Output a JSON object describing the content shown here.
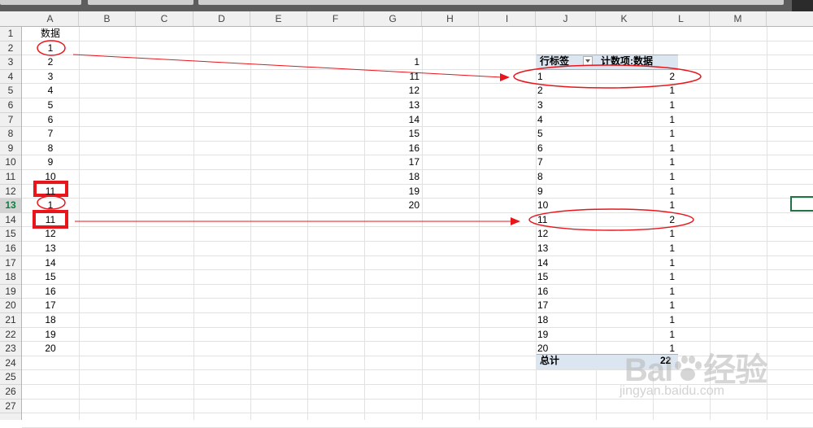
{
  "columns": [
    "A",
    "B",
    "C",
    "D",
    "E",
    "F",
    "G",
    "H",
    "I",
    "J",
    "K",
    "L",
    "M"
  ],
  "rows": [
    "1",
    "2",
    "3",
    "4",
    "5",
    "6",
    "7",
    "8",
    "9",
    "10",
    "11",
    "12",
    "13",
    "14",
    "15",
    "16",
    "17",
    "18",
    "19",
    "20",
    "21",
    "22",
    "23",
    "24",
    "25",
    "26",
    "27"
  ],
  "active_row": "13",
  "colA": {
    "header": "数据",
    "values": [
      "1",
      "2",
      "3",
      "4",
      "5",
      "6",
      "7",
      "8",
      "9",
      "10",
      "11",
      "1",
      "11",
      "12",
      "13",
      "14",
      "15",
      "16",
      "17",
      "18",
      "19",
      "20"
    ]
  },
  "colG": {
    "values": [
      "1",
      "11",
      "12",
      "13",
      "14",
      "15",
      "16",
      "17",
      "18",
      "19",
      "20"
    ]
  },
  "pivot": {
    "row_label": "行标签",
    "value_label": "计数项:数据",
    "labels": [
      "1",
      "2",
      "3",
      "4",
      "5",
      "6",
      "7",
      "8",
      "9",
      "10",
      "11",
      "12",
      "13",
      "14",
      "15",
      "16",
      "17",
      "18",
      "19",
      "20"
    ],
    "counts": [
      "2",
      "1",
      "1",
      "1",
      "1",
      "1",
      "1",
      "1",
      "1",
      "1",
      "2",
      "1",
      "1",
      "1",
      "1",
      "1",
      "1",
      "1",
      "1",
      "1"
    ],
    "total_label": "总计",
    "total_value": "22"
  },
  "watermark": {
    "logo": "Bai 经验",
    "url": "jingyan.baidu.com"
  },
  "annotation_color": "#e8161b",
  "selection_color": "#217346"
}
